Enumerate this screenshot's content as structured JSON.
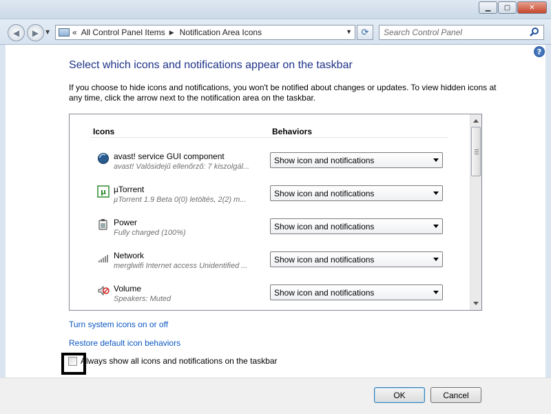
{
  "titlebar": {
    "minimize_glyph": "▁",
    "maximize_glyph": "▢",
    "close_glyph": "✕"
  },
  "address": {
    "back_glyph": "◀",
    "forward_glyph": "▶",
    "chevron": "«",
    "breadcrumbs": [
      "All Control Panel Items",
      "Notification Area Icons"
    ],
    "separator": "▶",
    "dropdown_glyph": "▼",
    "refresh_glyph": "⟳",
    "search_placeholder": "Search Control Panel"
  },
  "help_glyph": "?",
  "heading": "Select which icons and notifications appear on the taskbar",
  "description": "If you choose to hide icons and notifications, you won't be notified about changes or updates. To view hidden icons at any time, click the arrow next to the notification area on the taskbar.",
  "table": {
    "col_icons": "Icons",
    "col_behaviors": "Behaviors",
    "rows": [
      {
        "name": "avast! service GUI component",
        "sub": "avast! Valósidejű ellenőrző: 7 kiszolgál...",
        "behavior": "Show icon and notifications",
        "icon": "avast-icon"
      },
      {
        "name": "µTorrent",
        "sub": "µTorrent 1.9 Beta  0(0) letöltés, 2(2) m...",
        "behavior": "Show icon and notifications",
        "icon": "utorrent-icon"
      },
      {
        "name": "Power",
        "sub": "Fully charged (100%)",
        "behavior": "Show icon and notifications",
        "icon": "power-icon"
      },
      {
        "name": "Network",
        "sub": "merglwifi Internet access Unidentified ...",
        "behavior": "Show icon and notifications",
        "icon": "network-icon"
      },
      {
        "name": "Volume",
        "sub": "Speakers: Muted",
        "behavior": "Show icon and notifications",
        "icon": "volume-muted-icon"
      }
    ]
  },
  "links": {
    "system_icons": "Turn system icons on or off",
    "restore": "Restore default icon behaviors"
  },
  "always_show": {
    "label": "Always show all icons and notifications on the taskbar",
    "checked": false
  },
  "buttons": {
    "ok": "OK",
    "cancel": "Cancel"
  }
}
